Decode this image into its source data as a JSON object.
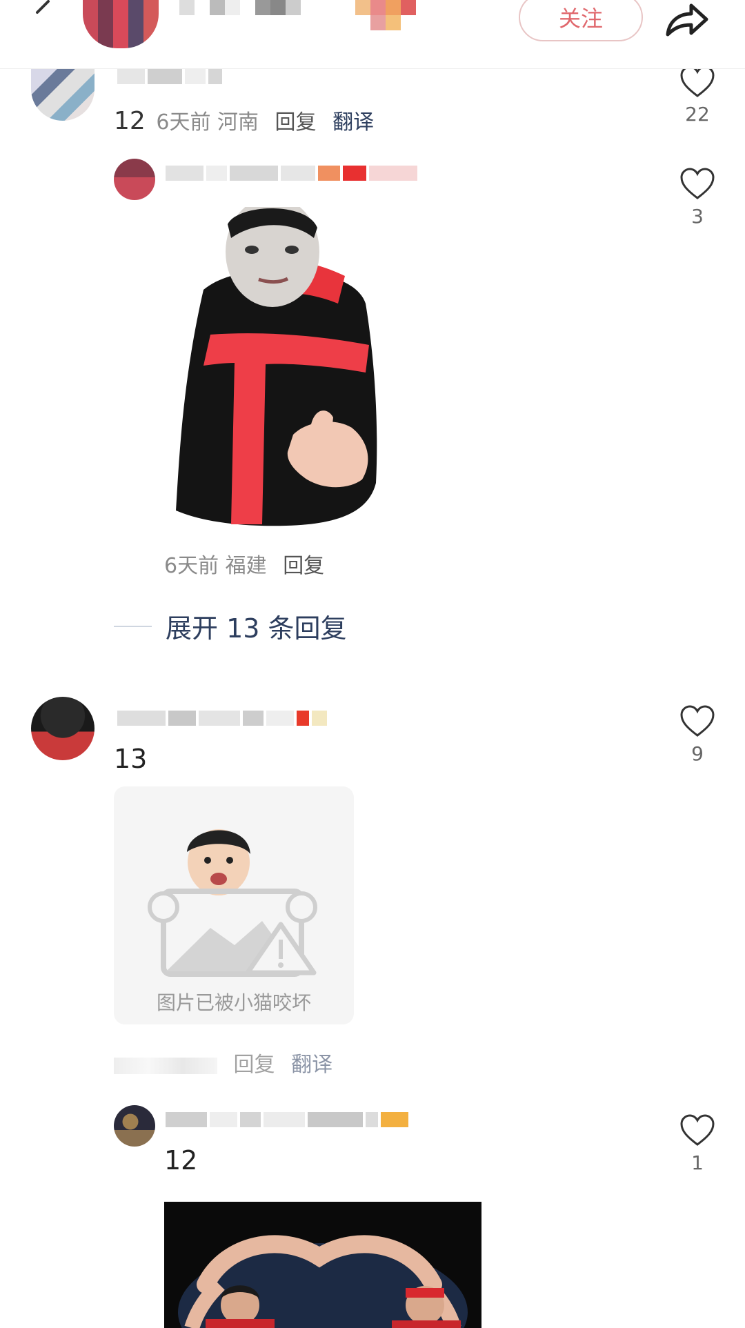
{
  "header": {
    "follow_label": "关注"
  },
  "comments": [
    {
      "number": "12",
      "time": "6天前",
      "location": "河南",
      "reply_label": "回复",
      "translate_label": "翻译",
      "likes": "22"
    },
    {
      "time": "6天前",
      "location": "福建",
      "reply_label": "回复",
      "likes": "3"
    },
    {
      "number": "13",
      "likes": "9",
      "broken_image_text": "图片已被小猫咬坏",
      "reply_label": "回复",
      "translate_label": "翻译"
    },
    {
      "number": "12",
      "likes": "1"
    }
  ],
  "expand_replies_label": "展开 13 条回复",
  "colors": {
    "accent_link": "#2d3e5e",
    "follow_red": "#e0686d",
    "muted": "#8a8a8a"
  },
  "icons": [
    "back-arrow-icon",
    "share-arrow-icon",
    "heart-icon"
  ]
}
